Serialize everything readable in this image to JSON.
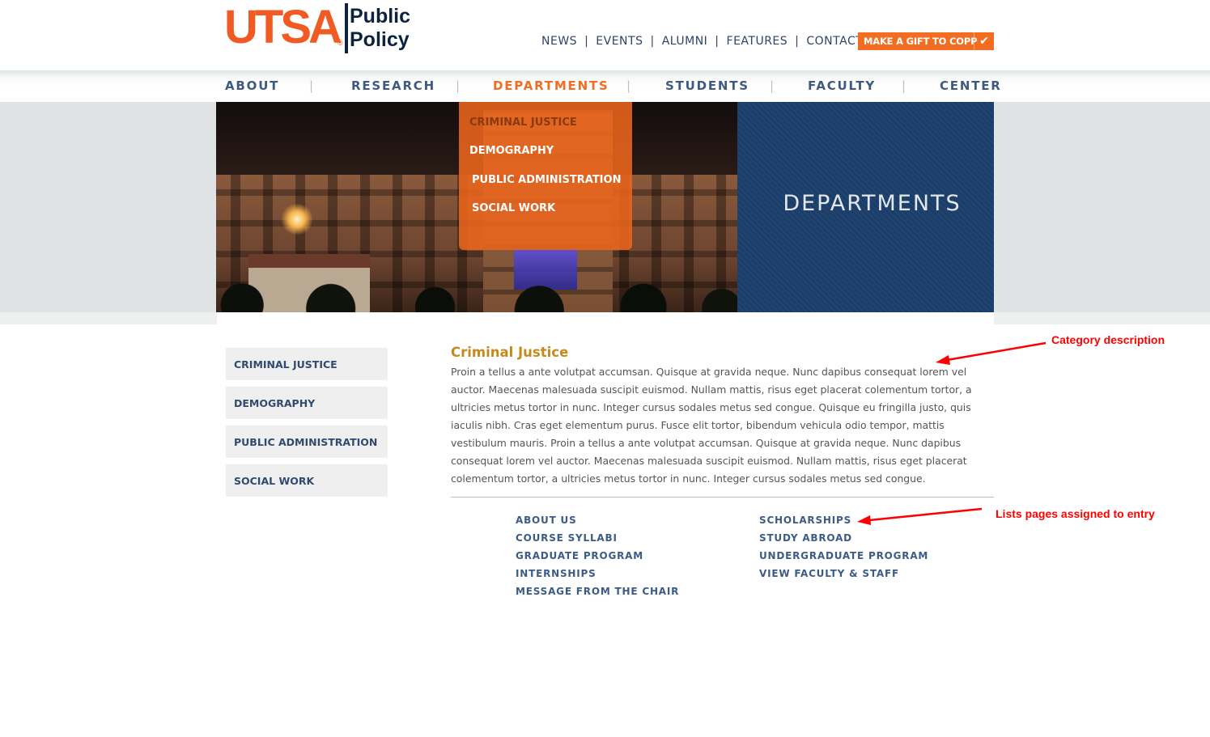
{
  "logo": {
    "mark": "UTSA",
    "reg": "®",
    "line1": "Public",
    "line2": "Policy"
  },
  "utility_nav": {
    "items": [
      "NEWS",
      "EVENTS",
      "ALUMNI",
      "FEATURES",
      "CONTACT"
    ],
    "separator": "|",
    "gift_button": "MAKE A GIFT TO COPP",
    "gift_icon": "checkmark-icon"
  },
  "main_nav": {
    "items": [
      "ABOUT",
      "RESEARCH",
      "DEPARTMENTS",
      "STUDENTS",
      "FACULTY",
      "CENTER"
    ],
    "active": "DEPARTMENTS",
    "separator": "|"
  },
  "dropdown": {
    "items": [
      "CRIMINAL JUSTICE",
      "DEMOGRAPHY",
      "PUBLIC ADMINISTRATION",
      "SOCIAL WORK"
    ],
    "highlighted": "CRIMINAL JUSTICE"
  },
  "hero": {
    "title": "DEPARTMENTS"
  },
  "sidebar": {
    "items": [
      "CRIMINAL JUSTICE",
      "DEMOGRAPHY",
      "PUBLIC ADMINISTRATION",
      "SOCIAL WORK"
    ]
  },
  "content": {
    "title": "Criminal Justice",
    "body": "Proin a tellus a ante volutpat accumsan. Quisque at gravida neque. Nunc dapibus consequat lorem vel auctor. Maecenas malesuada suscipit euismod. Nullam mattis, risus eget placerat colementum tortor, a ultricies metus tortor in nunc. Integer cursus sodales metus sed congue. Quisque eu fringilla justo, quis iaculis nibh. Cras eget elementum purus. Fusce elit tortor, bibendum vehicula odio tempor, mattis vestibulum mauris. Proin a tellus a ante volutpat accumsan. Quisque at gravida neque. Nunc dapibus consequat lorem vel auctor. Maecenas malesuada suscipit euismod. Nullam mattis, risus eget placerat colementum tortor, a ultricies metus tortor in nunc. Integer cursus sodales metus sed congue.",
    "links_left": [
      "ABOUT US",
      "COURSE SYLLABI",
      "GRADUATE PROGRAM",
      "INTERNSHIPS",
      "MESSAGE FROM THE CHAIR"
    ],
    "links_right": [
      "SCHOLARSHIPS",
      "STUDY ABROAD",
      "UNDERGRADUATE PROGRAM",
      "VIEW FACULTY & STAFF"
    ]
  },
  "annotations": {
    "category_description": "Category description",
    "lists_pages": "Lists pages assigned to entry"
  },
  "colors": {
    "brand_orange": "#f26d21",
    "brand_navy": "#0c2340",
    "nav_blue": "#3f5a80",
    "title_gold": "#c58a1e",
    "annotation_red": "#ff0000",
    "panel_blue": "#1a3e69"
  }
}
